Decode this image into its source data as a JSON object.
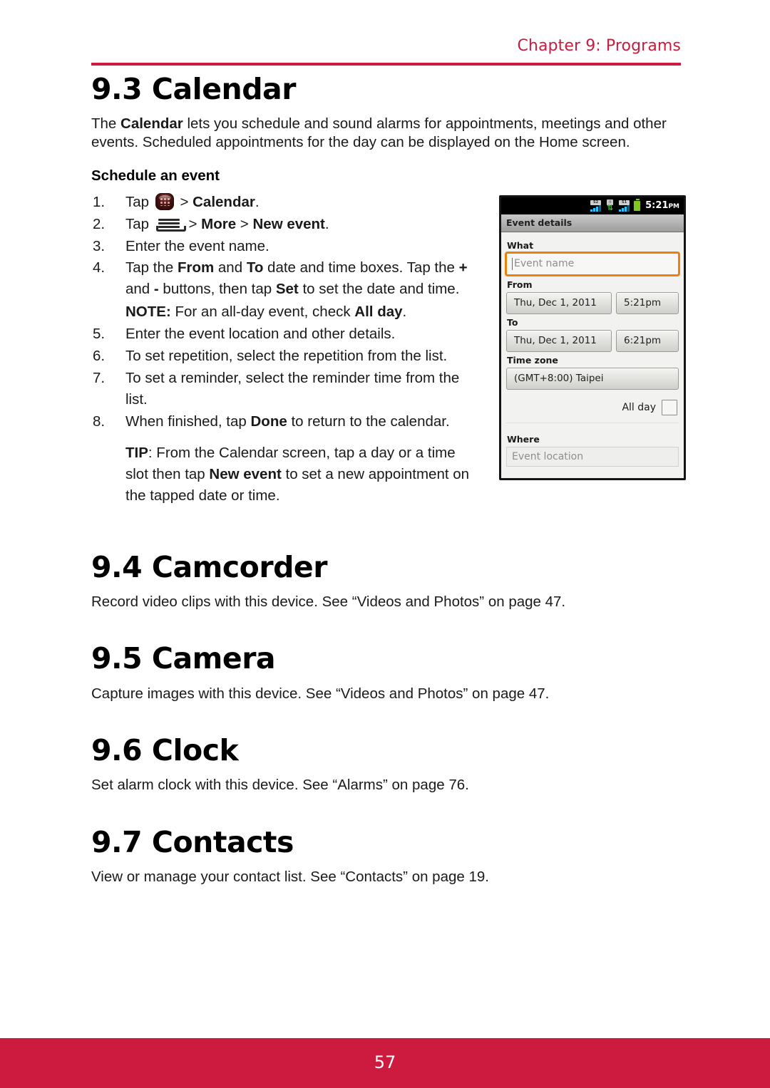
{
  "header": {
    "chapter": "Chapter 9: Programs",
    "rule_color": "#CD1A3F"
  },
  "sections": {
    "calendar": {
      "title": "9.3 Calendar",
      "intro_1": "The ",
      "intro_bold": "Calendar",
      "intro_2": " lets you schedule and sound alarms for appointments, meetings and other events. Scheduled appointments for the day can be displayed on the Home screen.",
      "sub_head": "Schedule an event",
      "steps": [
        {
          "num": "1.",
          "t1": "Tap ",
          "icon": "app-drawer-icon",
          "t2": " > ",
          "b1": "Calendar",
          "t3": "."
        },
        {
          "num": "2.",
          "t1": "Tap ",
          "icon": "menu-icon",
          "t2": " > ",
          "b1": "More",
          "t3": " > ",
          "b2": "New event",
          "t4": "."
        },
        {
          "num": "3.",
          "t1": "Enter the event name."
        },
        {
          "num": "4.",
          "t1": "Tap the ",
          "b1": "From",
          "t2": " and ",
          "b2": "To",
          "t3": " date and time boxes. Tap the ",
          "b3": "+",
          "t4": " and ",
          "b4": "-",
          "t5": " buttons, then tap ",
          "b5": "Set",
          "t6": " to set the date and time."
        },
        {
          "num": "5.",
          "t1": "Enter the event location and other details."
        },
        {
          "num": "6.",
          "t1": "To set repetition, select the repetition from the list."
        },
        {
          "num": "7.",
          "t1": "To set a reminder, select the reminder time from the list."
        },
        {
          "num": "8.",
          "t1": "When finished, tap ",
          "b1": "Done",
          "t2": " to return to the calendar."
        }
      ],
      "note_label": "NOTE:",
      "note_text_1": " For an all-day event, check ",
      "note_bold": "All day",
      "note_text_2": ".",
      "tip_label": "TIP",
      "tip_text_1": ": From the Calendar screen, tap a day or a time slot then tap ",
      "tip_bold": "New event",
      "tip_text_2": " to set a new appointment on the tapped date or time."
    },
    "camcorder": {
      "title": "9.4 Camcorder",
      "body": "Record video clips with this device. See “Videos and Photos” on page 47."
    },
    "camera": {
      "title": "9.5 Camera",
      "body": "Capture images with this device. See “Videos and Photos” on page 47."
    },
    "clock": {
      "title": "9.6 Clock",
      "body": "Set alarm clock with this device. See “Alarms” on page 76."
    },
    "contacts": {
      "title": "9.7 Contacts",
      "body": "View or manage your contact list. See “Contacts” on page 19."
    }
  },
  "phone": {
    "status": {
      "sim2_label": "S2",
      "sim1_label": "S1",
      "data_label": "II",
      "data_arrows": "⇅",
      "time": "5:21",
      "ampm": "PM"
    },
    "title_bar": "Event details",
    "what_label": "What",
    "event_name_placeholder": "Event name",
    "from_label": "From",
    "from_date": "Thu, Dec 1, 2011",
    "from_time": "5:21pm",
    "to_label": "To",
    "to_date": "Thu, Dec 1, 2011",
    "to_time": "6:21pm",
    "timezone_label": "Time zone",
    "timezone_value": "(GMT+8:00) Taipei",
    "allday_label": "All day",
    "where_label": "Where",
    "where_placeholder": "Event location",
    "focus_color": "#E8820C"
  },
  "footer": {
    "page_number": "57",
    "bar_color": "#CD1A3F"
  }
}
